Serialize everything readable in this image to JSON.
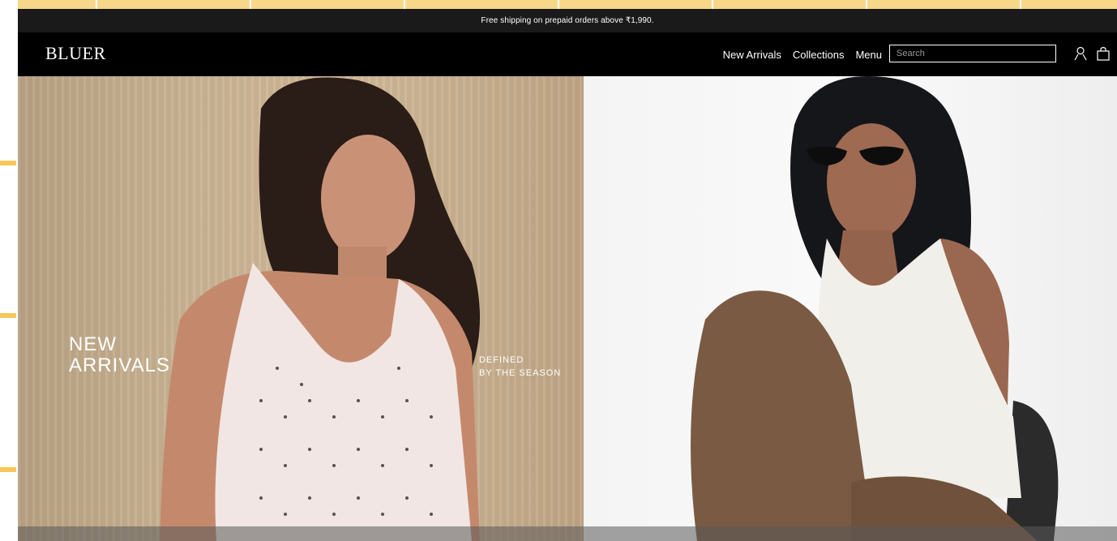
{
  "announcement": "Free shipping on prepaid orders above ₹1,990.",
  "header": {
    "logo": "BLUER",
    "nav": [
      {
        "label": "New Arrivals"
      },
      {
        "label": "Collections"
      },
      {
        "label": "Menu"
      }
    ],
    "search_placeholder": "Search",
    "icons": [
      "account-icon",
      "bag-icon"
    ]
  },
  "hero": {
    "title_line1": "NEW",
    "title_line2": "ARRIVALS",
    "sub_line1": "DEFINED",
    "sub_line2": "BY THE SEASON"
  },
  "colors": {
    "announce_bg": "#1a1a1a",
    "header_bg": "#000000",
    "left_panel": "#c9b393",
    "right_panel": "#f4f4f4",
    "accent_margin": "#f6c75a"
  }
}
